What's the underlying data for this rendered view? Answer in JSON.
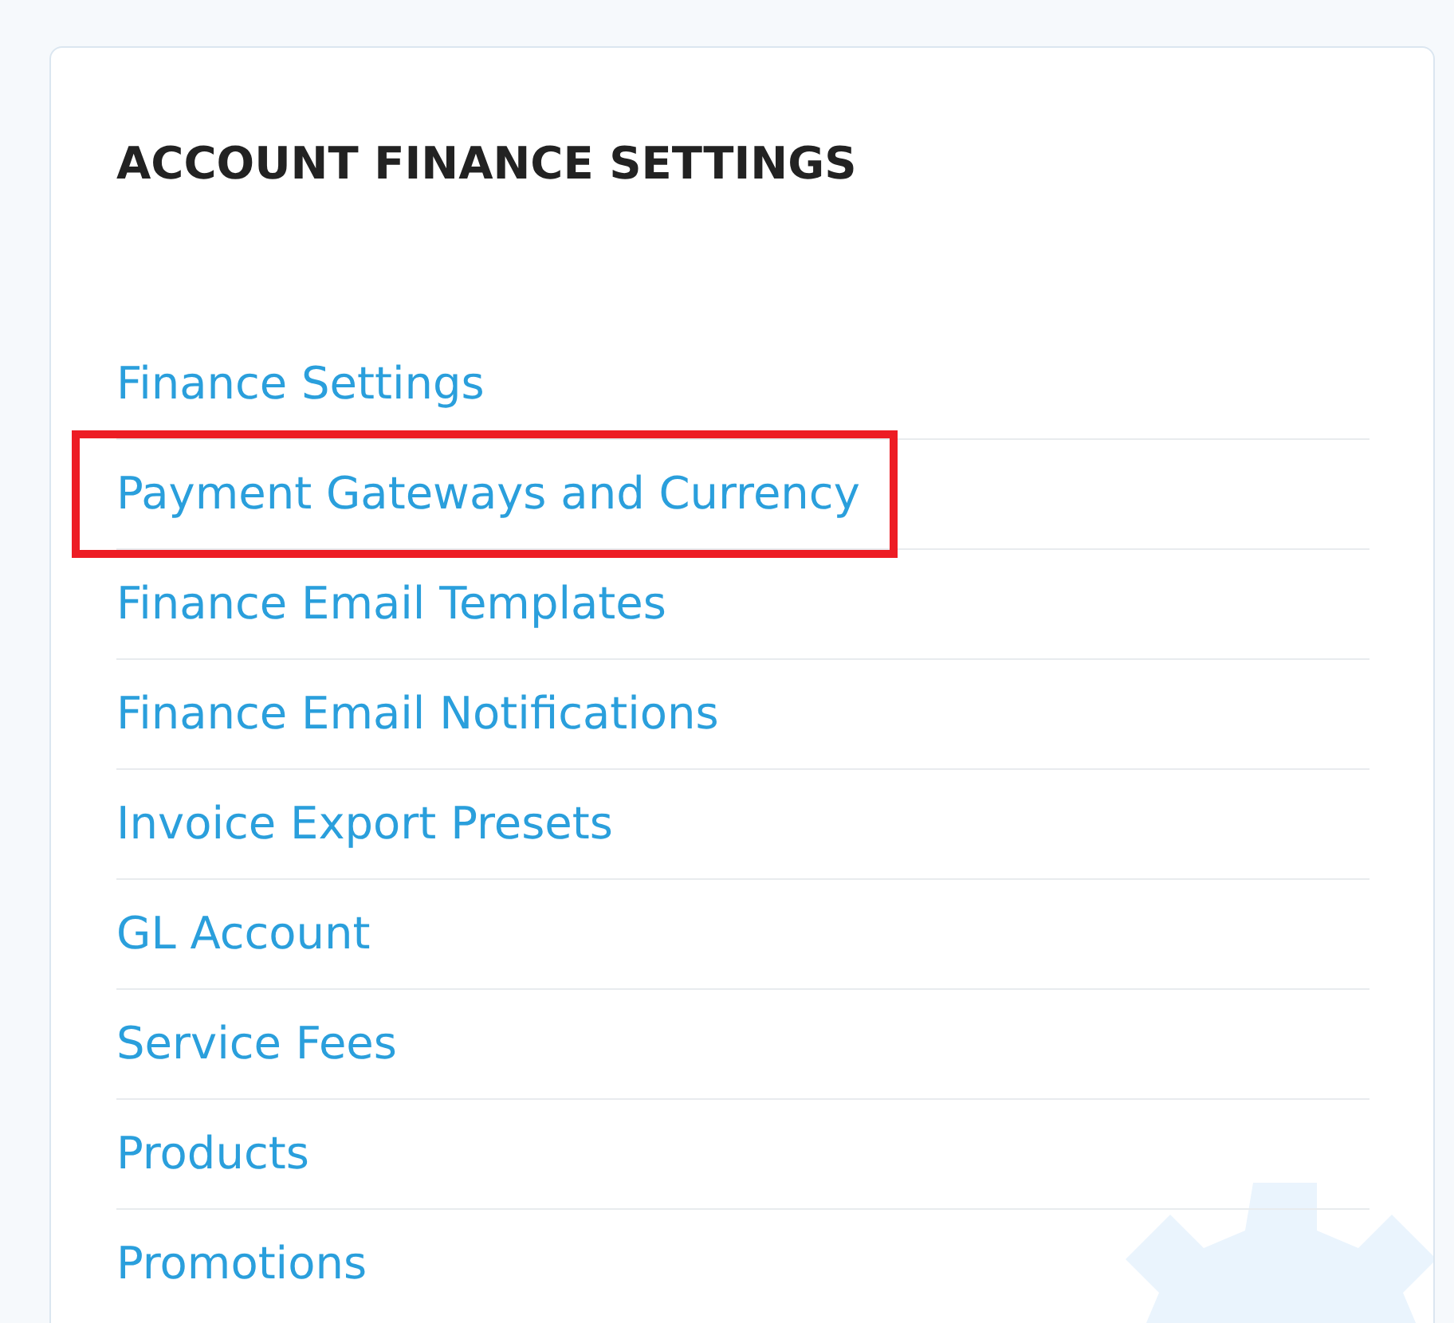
{
  "panel": {
    "title": "ACCOUNT FINANCE SETTINGS",
    "links": [
      {
        "label": "Finance Settings",
        "highlighted": false
      },
      {
        "label": "Payment Gateways and Currency",
        "highlighted": true
      },
      {
        "label": "Finance Email Templates",
        "highlighted": false
      },
      {
        "label": "Finance Email Notifications",
        "highlighted": false
      },
      {
        "label": "Invoice Export Presets",
        "highlighted": false
      },
      {
        "label": "GL Account",
        "highlighted": false
      },
      {
        "label": "Service Fees",
        "highlighted": false
      },
      {
        "label": "Products",
        "highlighted": false
      },
      {
        "label": "Promotions",
        "highlighted": false
      }
    ]
  }
}
